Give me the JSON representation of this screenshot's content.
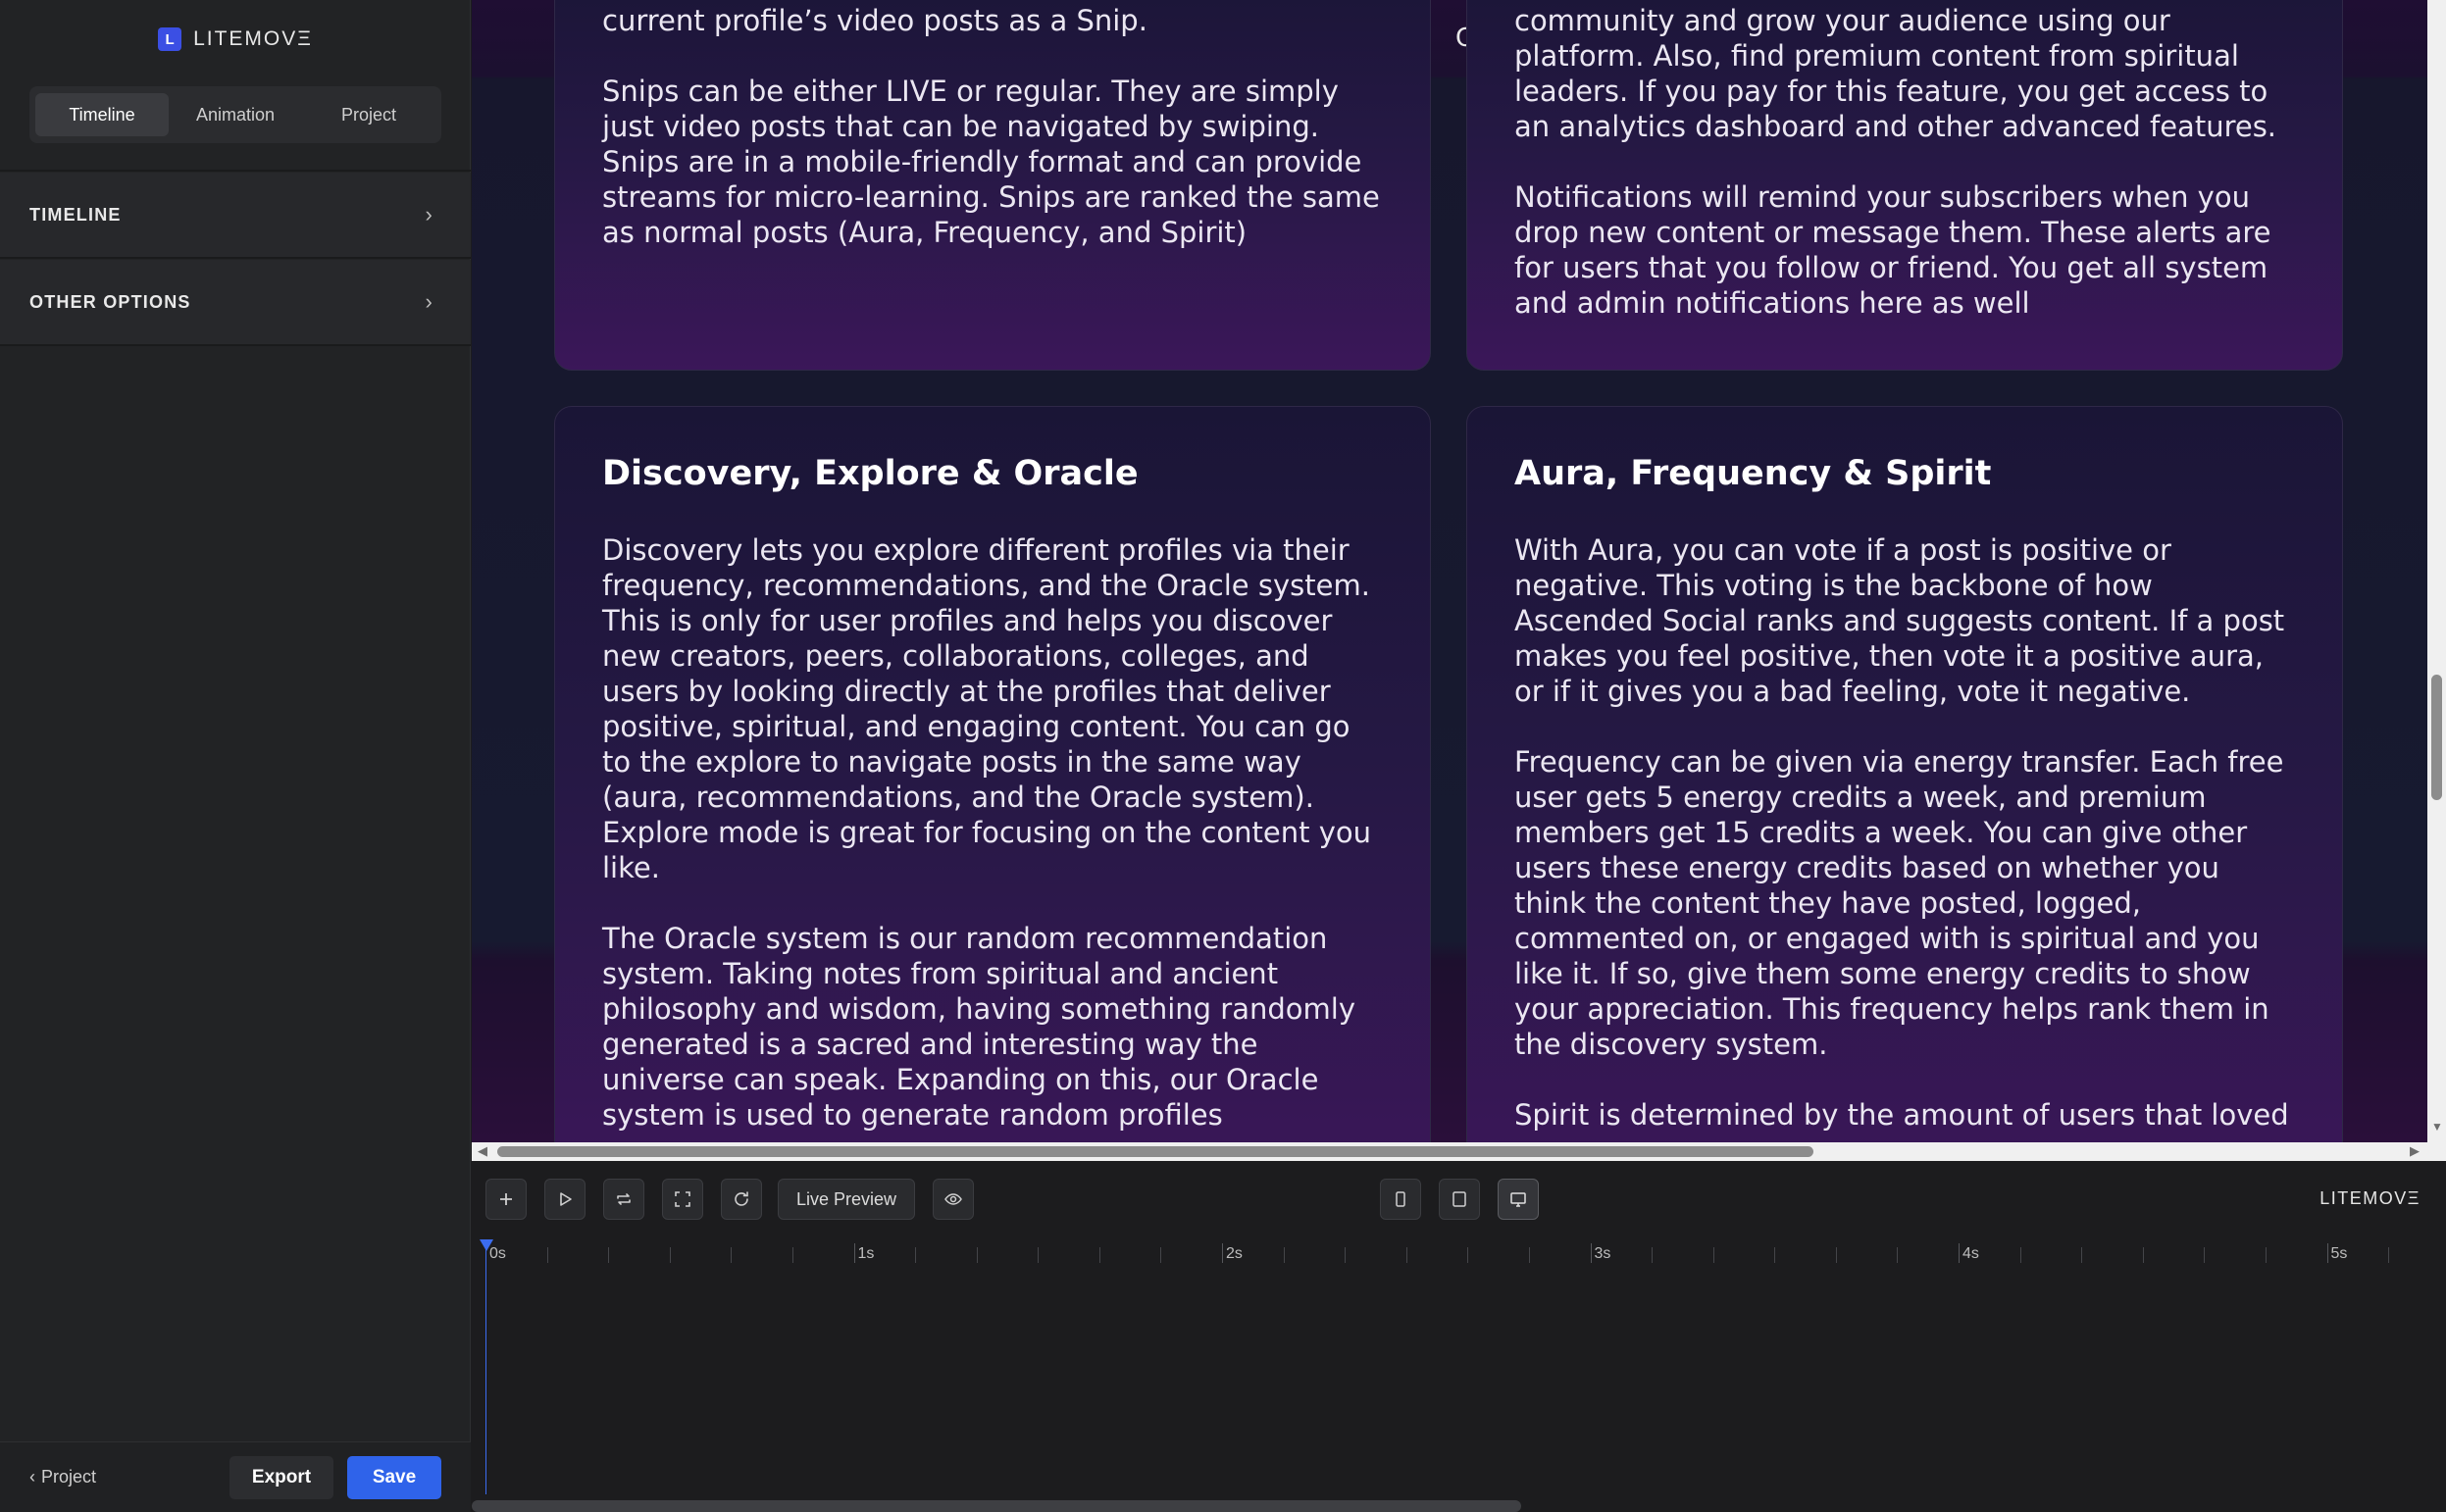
{
  "brand": {
    "logo_letter": "L",
    "name": "LITEMOVΞ"
  },
  "sidebar": {
    "tabs": [
      {
        "label": "Timeline",
        "active": true
      },
      {
        "label": "Animation",
        "active": false
      },
      {
        "label": "Project",
        "active": false
      }
    ],
    "sections": [
      {
        "label": "TIMELINE",
        "chevron": "›"
      },
      {
        "label": "OTHER OPTIONS",
        "chevron": "›"
      }
    ],
    "bottom": {
      "back_label": "Project",
      "back_icon": "‹",
      "export_label": "Export",
      "save_label": "Save"
    }
  },
  "preview": {
    "top_strip_text": "C",
    "cards": [
      {
        "title": "",
        "paragraphs": [
          "current profile’s video posts as a Snip.",
          "Snips can be either LIVE or regular. They are simply just video posts that can be navigated by swiping. Snips are in a mobile-friendly format and can provide streams for micro-learning. Snips are ranked the same as normal posts (Aura, Frequency, and Spirit)"
        ]
      },
      {
        "title": "",
        "paragraphs": [
          "community and grow your audience using our platform. Also, find premium content from spiritual leaders. If you pay for this feature, you get access to an analytics dashboard and other advanced features.",
          "Notifications will remind your subscribers when you drop new content or message them. These alerts are for users that you follow or friend. You get all system and admin notifications here as well"
        ]
      },
      {
        "title": "Discovery, Explore & Oracle",
        "paragraphs": [
          "Discovery lets you explore different profiles via their frequency, recommendations, and the Oracle system. This is only for user profiles and helps you discover new creators, peers, collaborations, colleges, and users by looking directly at the profiles that deliver positive, spiritual, and engaging content. You can go to the explore to navigate posts in the same way (aura, recommendations, and the Oracle system). Explore mode is great for focusing on the content you like.",
          "The Oracle system is our random recommendation system. Taking notes from spiritual and ancient philosophy and wisdom, having something randomly generated is a sacred and interesting way the universe can speak. Expanding on this, our Oracle system is used to generate random profiles"
        ]
      },
      {
        "title": "Aura, Frequency & Spirit",
        "paragraphs": [
          "With Aura, you can vote if a post is positive or negative. This voting is the backbone of how Ascended Social ranks and suggests content. If a post makes you feel positive, then vote it a positive aura, or if it gives you a bad feeling, vote it negative.",
          "Frequency can be given via energy transfer. Each free user gets 5 energy credits a week, and premium members get 15 credits a week. You can give other users these energy credits based on whether you think the content they have posted, logged, commented on, or engaged with is spiritual and you like it. If so, give them some energy credits to show your appreciation. This frequency helps rank them in the discovery system.",
          "Spirit is determined by the amount of users that loved"
        ]
      }
    ]
  },
  "timeline": {
    "toolbar": {
      "add_icon": "plus-icon",
      "play_icon": "play-icon",
      "loop_icon": "loop-icon",
      "fullscreen_icon": "fullscreen-icon",
      "refresh_icon": "refresh-icon",
      "live_preview_label": "Live Preview",
      "eye_icon": "eye-icon",
      "device_mobile_icon": "mobile-icon",
      "device_tablet_icon": "tablet-icon",
      "device_desktop_icon": "desktop-icon",
      "active_device": "desktop"
    },
    "brand_label": "LITEMOVΞ",
    "ruler_labels": [
      "0s",
      "1s",
      "2s",
      "3s",
      "4s",
      "5s"
    ]
  },
  "colors": {
    "accent": "#2f63ea",
    "playhead": "#3b6cf0"
  }
}
